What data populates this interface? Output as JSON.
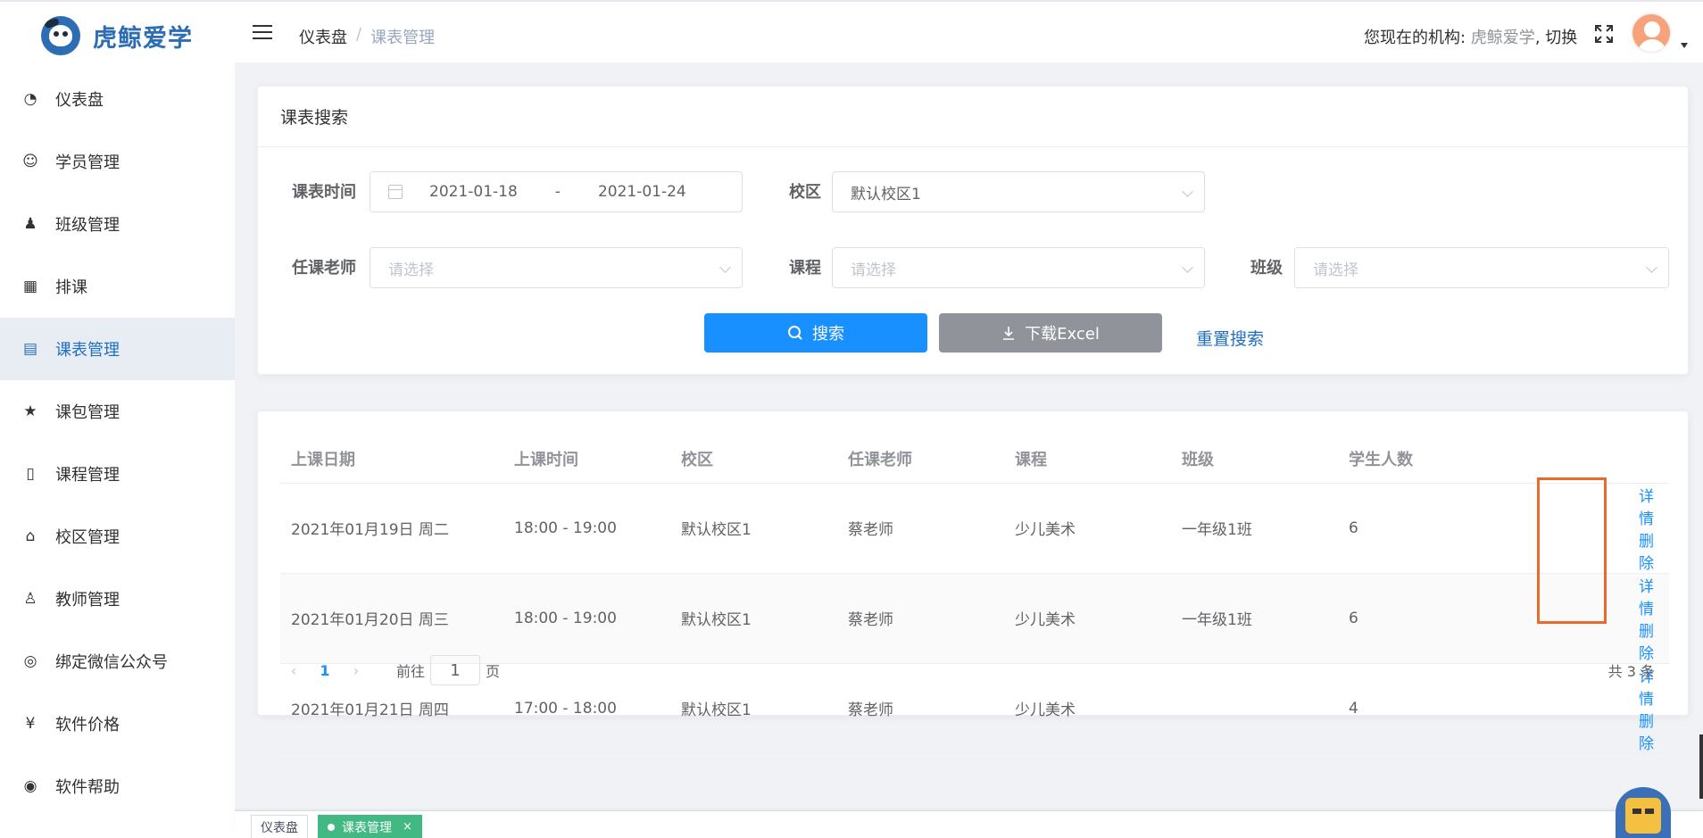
{
  "app": {
    "name": "虎鲸爱学"
  },
  "sidebar": {
    "items": [
      {
        "label": "仪表盘",
        "icon": "dashboard-icon",
        "glyph": "◔"
      },
      {
        "label": "学员管理",
        "icon": "student-icon",
        "glyph": "☺"
      },
      {
        "label": "班级管理",
        "icon": "class-icon",
        "glyph": "♟"
      },
      {
        "label": "排课",
        "icon": "calendar-icon",
        "glyph": "▦"
      },
      {
        "label": "课表管理",
        "icon": "timetable-icon",
        "glyph": "▤",
        "active": true
      },
      {
        "label": "课包管理",
        "icon": "star-icon",
        "glyph": "★"
      },
      {
        "label": "课程管理",
        "icon": "book-icon",
        "glyph": "▯"
      },
      {
        "label": "校区管理",
        "icon": "school-icon",
        "glyph": "⌂"
      },
      {
        "label": "教师管理",
        "icon": "teacher-icon",
        "glyph": "♙"
      },
      {
        "label": "绑定微信公众号",
        "icon": "wechat-icon",
        "glyph": "◎"
      },
      {
        "label": "软件价格",
        "icon": "yen-icon",
        "glyph": "¥"
      },
      {
        "label": "软件帮助",
        "icon": "globe-icon",
        "glyph": "◉"
      }
    ]
  },
  "header": {
    "breadcrumb": [
      "仪表盘",
      "课表管理"
    ],
    "breadcrumb_sep": "/",
    "org_label": "您现在的机构:",
    "org_value": "虎鲸爱学",
    "org_switch": ", 切换"
  },
  "search": {
    "title": "课表搜索",
    "date_label": "课表时间",
    "date_start": "2021-01-18",
    "date_sep": "-",
    "date_end": "2021-01-24",
    "campus_label": "校区",
    "campus_value": "默认校区1",
    "teacher_label": "任课老师",
    "teacher_placeholder": "请选择",
    "course_label": "课程",
    "course_placeholder": "请选择",
    "class_label": "班级",
    "class_placeholder": "请选择",
    "search_button": "搜索",
    "excel_button": "下载Excel",
    "reset_link": "重置搜索"
  },
  "table": {
    "headers": [
      "上课日期",
      "上课时间",
      "校区",
      "任课老师",
      "课程",
      "班级",
      "学生人数",
      ""
    ],
    "rows": [
      {
        "date": "2021年01月19日 周二",
        "time": "18:00 - 19:00",
        "campus": "默认校区1",
        "teacher": "蔡老师",
        "course": "少儿美术",
        "class": "一年级1班",
        "students": "6"
      },
      {
        "date": "2021年01月20日 周三",
        "time": "18:00 - 19:00",
        "campus": "默认校区1",
        "teacher": "蔡老师",
        "course": "少儿美术",
        "class": "一年级1班",
        "students": "6"
      },
      {
        "date": "2021年01月21日 周四",
        "time": "17:00 - 18:00",
        "campus": "默认校区1",
        "teacher": "蔡老师",
        "course": "少儿美术",
        "class": "",
        "students": "4"
      }
    ],
    "detail_link": "详情",
    "delete_link": "删除"
  },
  "pagination": {
    "current_page": "1",
    "goto_prefix": "前往",
    "goto_value": "1",
    "goto_suffix": "页",
    "total": "共 3 条"
  },
  "tags": [
    {
      "label": "仪表盘"
    },
    {
      "label": "课表管理",
      "active": true,
      "close": "×"
    }
  ],
  "colors": {
    "primary": "#1890ff",
    "brand": "#2d6db5",
    "tag_active": "#42b983",
    "highlight": "#ea6a2e"
  }
}
